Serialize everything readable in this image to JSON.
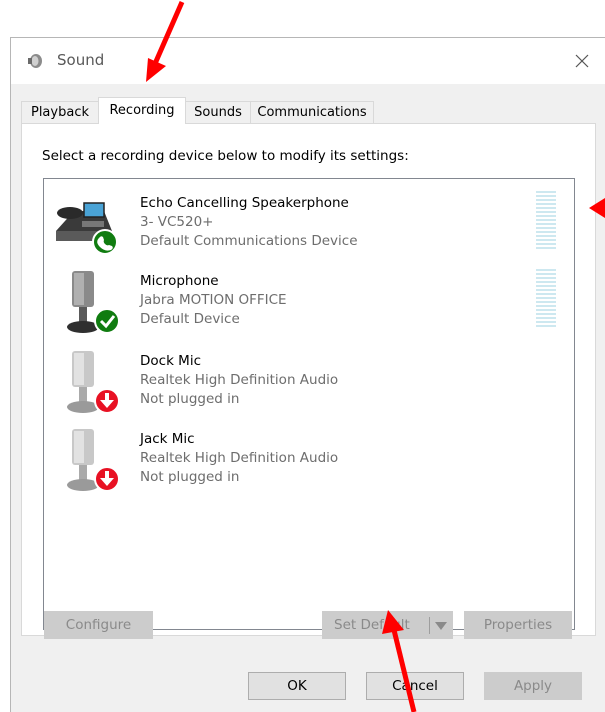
{
  "window": {
    "title": "Sound",
    "close_glyph": "✕"
  },
  "tabs": [
    {
      "label": "Playback",
      "active": false
    },
    {
      "label": "Recording",
      "active": true
    },
    {
      "label": "Sounds",
      "active": false
    },
    {
      "label": "Communications",
      "active": false
    }
  ],
  "instruction": "Select a recording device below to modify its settings:",
  "devices": [
    {
      "name": "Echo Cancelling Speakerphone",
      "subtitle": "3- VC520+",
      "status": "Default Communications Device",
      "icon": "speakerphone-icon",
      "badge": "phone-badge-icon",
      "has_meter": true
    },
    {
      "name": "Microphone",
      "subtitle": "Jabra MOTION OFFICE",
      "status": "Default Device",
      "icon": "microphone-icon",
      "badge": "check-badge-icon",
      "has_meter": true
    },
    {
      "name": "Dock Mic",
      "subtitle": "Realtek High Definition Audio",
      "status": "Not plugged in",
      "icon": "microphone-icon",
      "badge": "unplugged-badge-icon",
      "has_meter": false
    },
    {
      "name": "Jack Mic",
      "subtitle": "Realtek High Definition Audio",
      "status": "Not plugged in",
      "icon": "microphone-icon",
      "badge": "unplugged-badge-icon",
      "has_meter": false
    }
  ],
  "buttons": {
    "configure": "Configure",
    "set_default": "Set Default",
    "properties": "Properties",
    "ok": "OK",
    "cancel": "Cancel",
    "apply": "Apply"
  },
  "colors": {
    "annotation_arrow": "#ff0000",
    "badge_green": "#107c10",
    "badge_red": "#e81123",
    "meter_bar": "#cde8f0"
  }
}
